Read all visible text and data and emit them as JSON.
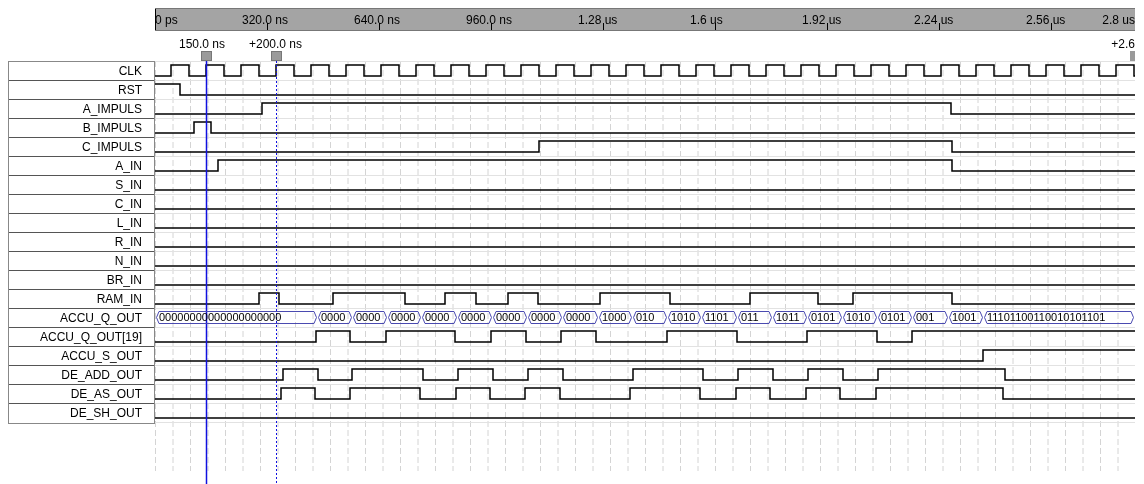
{
  "ruler": {
    "ticks": [
      "0 ps",
      "320.0 ns",
      "640.0 ns",
      "960.0 ns",
      "1.28 us",
      "1.6 us",
      "1.92 us",
      "2.24 us",
      "2.56 us",
      "2.8 us"
    ]
  },
  "cursors": [
    {
      "label": "150.0 ns",
      "kind": "solid"
    },
    {
      "label": "+200.0 ns",
      "kind": "dotted"
    },
    {
      "label": "+2.6",
      "kind": "edge"
    }
  ],
  "signals": [
    {
      "name": "CLK",
      "kind": "bit"
    },
    {
      "name": "RST",
      "kind": "bit"
    },
    {
      "name": "A_IMPULS",
      "kind": "bit"
    },
    {
      "name": "B_IMPULS",
      "kind": "bit"
    },
    {
      "name": "C_IMPULS",
      "kind": "bit"
    },
    {
      "name": "A_IN",
      "kind": "bit"
    },
    {
      "name": "S_IN",
      "kind": "bit"
    },
    {
      "name": "C_IN",
      "kind": "bit"
    },
    {
      "name": "L_IN",
      "kind": "bit"
    },
    {
      "name": "R_IN",
      "kind": "bit"
    },
    {
      "name": "N_IN",
      "kind": "bit"
    },
    {
      "name": "BR_IN",
      "kind": "bit"
    },
    {
      "name": "RAM_IN",
      "kind": "bit"
    },
    {
      "name": "ACCU_Q_OUT",
      "kind": "bus",
      "values": [
        "00000000000000000000",
        "0000",
        "0000",
        "0000",
        "0000",
        "0000",
        "0000",
        "0000",
        "0000",
        "1000",
        "010",
        "1010",
        "1101",
        "011",
        "1011",
        "0101",
        "1010",
        "0101",
        "001",
        "1001",
        "11101100110010101101"
      ]
    },
    {
      "name": "ACCU_Q_OUT[19]",
      "kind": "bit"
    },
    {
      "name": "ACCU_S_OUT",
      "kind": "bit"
    },
    {
      "name": "DE_ADD_OUT",
      "kind": "bit"
    },
    {
      "name": "DE_AS_OUT",
      "kind": "bit"
    },
    {
      "name": "DE_SH_OUT",
      "kind": "bit"
    }
  ]
}
